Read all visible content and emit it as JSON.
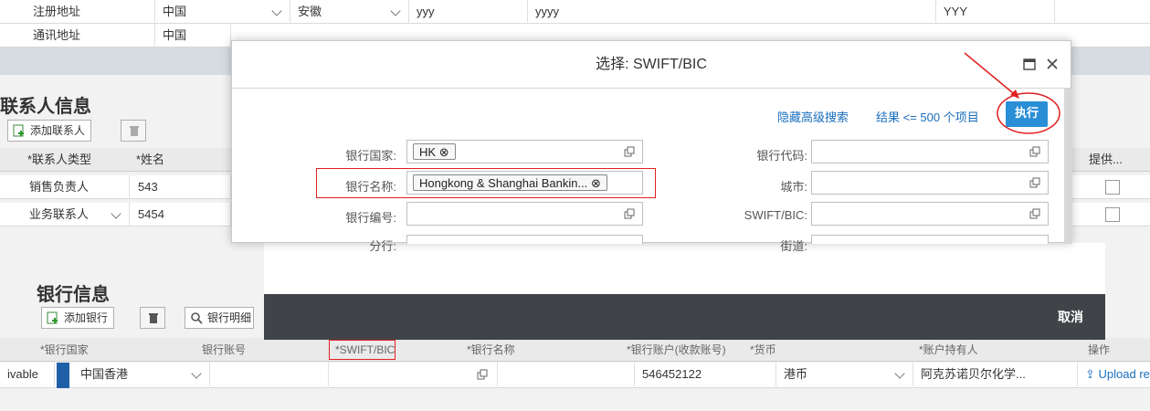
{
  "address_rows": [
    {
      "label": "注册地址",
      "country": "中国",
      "province": "安徽",
      "city": "yyy",
      "street": "yyyy",
      "extra": "YYY"
    },
    {
      "label": "通讯地址",
      "country": "中国"
    }
  ],
  "contacts": {
    "title": "联系人信息",
    "add_label": "添加联系人",
    "headers": [
      "*联系人类型",
      "*姓名",
      "提供..."
    ],
    "rows": [
      {
        "type": "销售负责人",
        "name": "543"
      },
      {
        "type": "业务联系人",
        "name": "5454"
      }
    ]
  },
  "bank": {
    "title": "银行信息",
    "add_label": "添加银行",
    "details_label": "银行明细",
    "headers": [
      "*银行国家",
      "银行账号",
      "*SWIFT/BIC",
      "*银行名称",
      "*银行账户(收款账号)",
      "*货币",
      "*账户持有人",
      "操作"
    ],
    "row": {
      "prefix": "ivable",
      "country": "中国香港",
      "account": "546452122",
      "currency": "港币",
      "holder": "阿克苏诺贝尔化学...",
      "upload": "Upload rece"
    }
  },
  "dialog": {
    "title": "选择: SWIFT/BIC",
    "hide_search": "隐藏高级搜索",
    "result_limit": "结果 <= 500 个项目",
    "go_label": "执行",
    "cancel_label": "取消",
    "fields_left": [
      {
        "label": "银行国家:",
        "token": "HK"
      },
      {
        "label": "银行名称:",
        "token": "Hongkong & Shanghai Bankin..."
      },
      {
        "label": "银行编号:",
        "token": ""
      },
      {
        "label": "分行:",
        "token": ""
      }
    ],
    "fields_right": [
      {
        "label": "银行代码:"
      },
      {
        "label": "城市:"
      },
      {
        "label": "SWIFT/BIC:"
      },
      {
        "label": "街道:"
      }
    ]
  },
  "colors": {
    "accent": "#2a8fd6",
    "highlight_red": "#e02020",
    "footer": "#404448",
    "link": "#1a6ebd"
  }
}
